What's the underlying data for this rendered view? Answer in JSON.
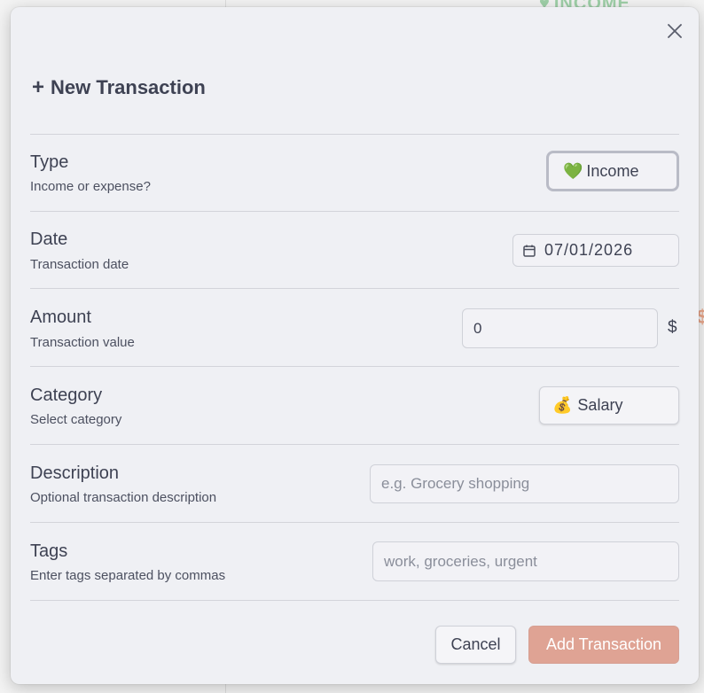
{
  "background": {
    "ghost_income": "INCOME",
    "ghost_dollar": "$"
  },
  "modal": {
    "title_icon": "+",
    "title": "New Transaction",
    "close_icon": "close-icon"
  },
  "fields": {
    "type": {
      "label": "Type",
      "hint": "Income or expense?",
      "value_emoji": "💚",
      "value": "Income"
    },
    "date": {
      "label": "Date",
      "hint": "Transaction date",
      "value": "07/01/2026",
      "icon": "calendar-icon"
    },
    "amount": {
      "label": "Amount",
      "hint": "Transaction value",
      "value": "0",
      "currency": "$"
    },
    "category": {
      "label": "Category",
      "hint": "Select category",
      "value_emoji": "💰",
      "value": "Salary"
    },
    "description": {
      "label": "Description",
      "hint": "Optional transaction description",
      "placeholder": "e.g. Grocery shopping"
    },
    "tags": {
      "label": "Tags",
      "hint": "Enter tags separated by commas",
      "placeholder": "work, groceries, urgent"
    }
  },
  "actions": {
    "cancel_label": "Cancel",
    "submit_label": "Add Transaction"
  },
  "colors": {
    "modal_bg": "#eff0f4",
    "text": "#3e4253",
    "submit_bg": "#dfa394",
    "divider": "#d3d4da"
  }
}
